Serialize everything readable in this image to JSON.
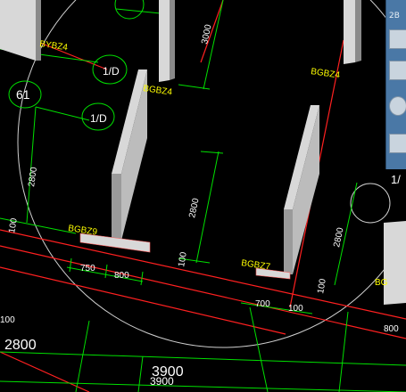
{
  "colors": {
    "background": "#000000",
    "dimension": "#00ff00",
    "axis": "#ff2020",
    "label": "#ffff00",
    "text": "#ffffff",
    "wall_light": "#d8d8d8",
    "wall_dark": "#8a8a8a",
    "toolbar": "#4a78a6"
  },
  "drawing": {
    "wall_labels": [
      "BYBZ4",
      "BGBZ4",
      "BGBZ9",
      "BGBZ7",
      "BG",
      "BGBZ4"
    ],
    "axis_bubbles": [
      "1/D",
      "61",
      "1/D",
      "1/"
    ],
    "dimensions": [
      "3000",
      "2800",
      "2800",
      "2800",
      "750",
      "800",
      "700",
      "100",
      "100",
      "100",
      "100",
      "800",
      "100",
      "2800",
      "3900",
      "3900"
    ],
    "toolbar_text": "2B"
  }
}
